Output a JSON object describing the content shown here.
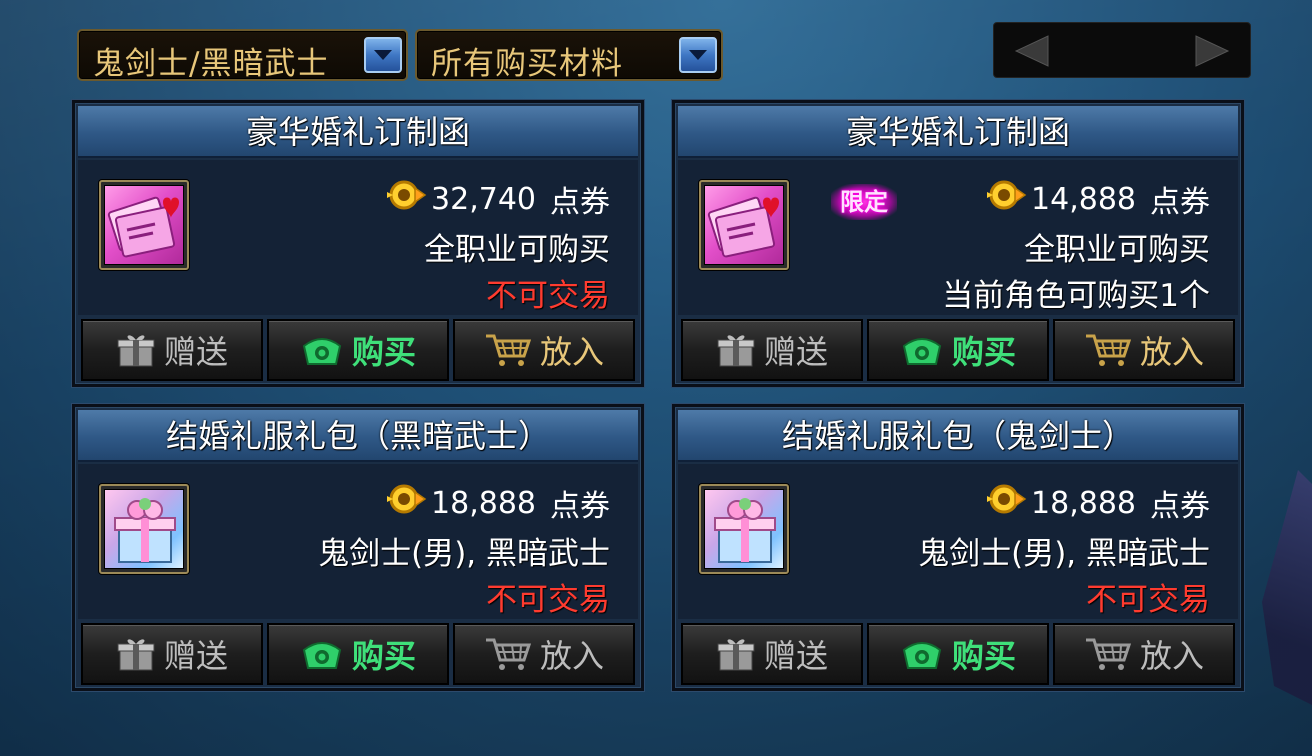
{
  "filters": {
    "job_select": "鬼剑士/黑暗武士",
    "material_select": "所有购买材料"
  },
  "colors": {
    "price_note_red": "#ff3b2f",
    "buy_green": "#3fe07a",
    "gold": "#e8c77a"
  },
  "items": [
    {
      "title": "豪华婚礼订制函",
      "price": "32,740",
      "currency": "点券",
      "line1": "全职业可购买",
      "line2": "不可交易",
      "limited": "",
      "icon": "wedding-invitation-icon",
      "buttons": {
        "gift": "赠送",
        "buy": "购买",
        "cart": "放入"
      }
    },
    {
      "title": "豪华婚礼订制函",
      "price": "14,888",
      "currency": "点券",
      "line1": "全职业可购买",
      "line2": "当前角色可购买1个",
      "limited": "限定",
      "icon": "wedding-invitation-icon",
      "buttons": {
        "gift": "赠送",
        "buy": "购买",
        "cart": "放入"
      }
    },
    {
      "title": "结婚礼服礼包（黑暗武士）",
      "price": "18,888",
      "currency": "点券",
      "line1": "鬼剑士(男), 黑暗武士",
      "line2": "不可交易",
      "limited": "",
      "icon": "gift-box-icon",
      "buttons": {
        "gift": "赠送",
        "buy": "购买",
        "cart": "放入"
      }
    },
    {
      "title": "结婚礼服礼包（鬼剑士）",
      "price": "18,888",
      "currency": "点券",
      "line1": "鬼剑士(男), 黑暗武士",
      "line2": "不可交易",
      "limited": "",
      "icon": "gift-box-icon",
      "buttons": {
        "gift": "赠送",
        "buy": "购买",
        "cart": "放入"
      }
    }
  ]
}
